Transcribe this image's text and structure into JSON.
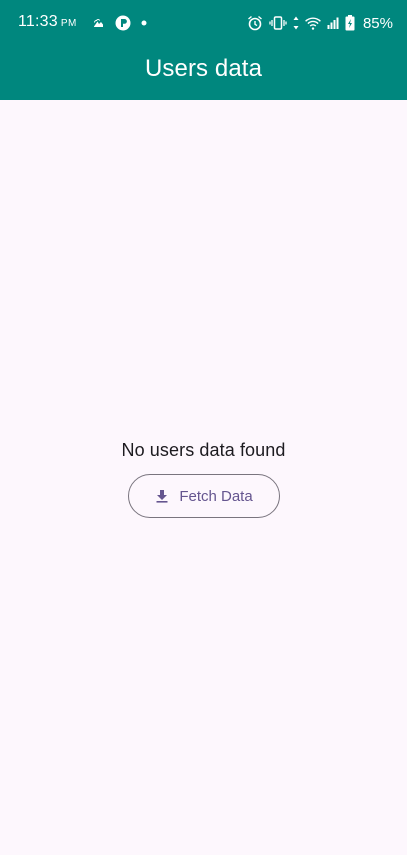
{
  "status_bar": {
    "time": "11:33",
    "ampm": "PM",
    "battery": "85%",
    "left_icons": [
      "cloud-icon",
      "app-badge-icon",
      "notification-dot-icon"
    ],
    "right_icons": [
      "alarm-icon",
      "vibrate-icon",
      "data-arrows-icon",
      "wifi-icon",
      "signal-icon",
      "battery-charging-icon"
    ]
  },
  "app_bar": {
    "title": "Users data",
    "color": "#00877e"
  },
  "empty_state": {
    "message": "No users data found"
  },
  "fetch_button": {
    "label": "Fetch Data",
    "icon": "download-icon",
    "color": "#65558f"
  }
}
